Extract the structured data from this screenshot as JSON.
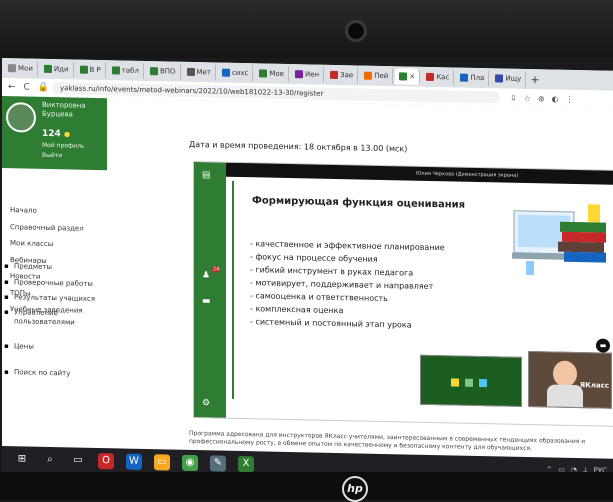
{
  "tabs": [
    {
      "label": "Мои",
      "color": "#888888"
    },
    {
      "label": "Иди",
      "color": "#2e7d32"
    },
    {
      "label": "В Р",
      "color": "#2e7d32"
    },
    {
      "label": "табл",
      "color": "#2e7d32"
    },
    {
      "label": "ВПО",
      "color": "#2e7d32"
    },
    {
      "label": "Мет",
      "color": "#555555"
    },
    {
      "label": "сихс",
      "color": "#1565c0"
    },
    {
      "label": "Мое",
      "color": "#2e7d32"
    },
    {
      "label": "Иен",
      "color": "#7b1fa2"
    },
    {
      "label": "Зае",
      "color": "#c62828"
    },
    {
      "label": "Пей",
      "color": "#ef6c00"
    },
    {
      "label": "×",
      "color": "#2e7d32"
    },
    {
      "label": "Кас",
      "color": "#c62828"
    },
    {
      "label": "Пла",
      "color": "#1565c0"
    },
    {
      "label": "Ищу",
      "color": "#3949ab"
    }
  ],
  "tab_plus": "+",
  "address": {
    "url": "yaklass.ru/info/events/metod-webinars/2022/10/web181022-13-30/register",
    "back": "←",
    "reload": "C",
    "home": "⌂",
    "lock": "🔒",
    "tools": [
      "⇩",
      "☆",
      "⊕",
      "◐",
      "⋮"
    ]
  },
  "sidebar": {
    "user_lines": [
      "Викторовна",
      "Бурцева"
    ],
    "points": "124",
    "coin": "●",
    "profile": "Мой профиль",
    "logout": "Выйти",
    "menu": [
      "Начало",
      "Справочный раздел",
      "Мои классы",
      "Вебинары",
      "Новости",
      "ТОПы",
      "Учебные заведения"
    ],
    "menu2": [
      {
        "label": "Предметы",
        "icon": "▪"
      },
      {
        "label": "Проверочные работы",
        "icon": "▪"
      },
      {
        "label": "Результаты учащихся",
        "icon": "▪"
      },
      {
        "label": "Управление",
        "icon": "▪"
      },
      {
        "label": "пользователями",
        "icon": ""
      },
      {
        "label": "Цены",
        "icon": "▪"
      },
      {
        "label": "Поиск по сайту",
        "icon": "▪"
      }
    ]
  },
  "main": {
    "date_line": "Дата и время проведения: 18 октября в 13.00 (мск)",
    "presenter": "Юлия Черкова (Демонстрация экрана)",
    "slide_title": "Формирующая функция оценивания",
    "bullets": [
      "качественное и эффективное планирование",
      "фокус на процессе обучения",
      "гибкий инструмент в руках педагога",
      "мотивирует, поддерживает и направляет",
      "самооценка и ответственность",
      "комплексная оценка",
      "системный и постоянный этап урока"
    ],
    "participants_badge": "24",
    "cam_label": "ЯКласс",
    "chat_icon": "▬",
    "bottom_text": "Программа адресована для инструкторов ЯКласс учителями, заинтересованным в современных тенденциях образования и профессиональному росту, в обмене опытом по качественному и безопасному контенту для обучающихся."
  },
  "taskbar": {
    "icons": [
      {
        "glyph": "⊞",
        "color": "#1f1f24"
      },
      {
        "glyph": "⌕",
        "color": "#1f1f24"
      },
      {
        "glyph": "▭",
        "color": "#1f1f24"
      },
      {
        "glyph": "O",
        "color": "#c62828"
      },
      {
        "glyph": "W",
        "color": "#1565c0"
      },
      {
        "glyph": "▭",
        "color": "#f9a825"
      },
      {
        "glyph": "◉",
        "color": "#43a047"
      },
      {
        "glyph": "✎",
        "color": "#546e7a"
      },
      {
        "glyph": "X",
        "color": "#2e7d32"
      }
    ],
    "tray": [
      "^",
      "▭",
      "◔",
      "⟂",
      "РУС"
    ]
  },
  "brand": "hp"
}
